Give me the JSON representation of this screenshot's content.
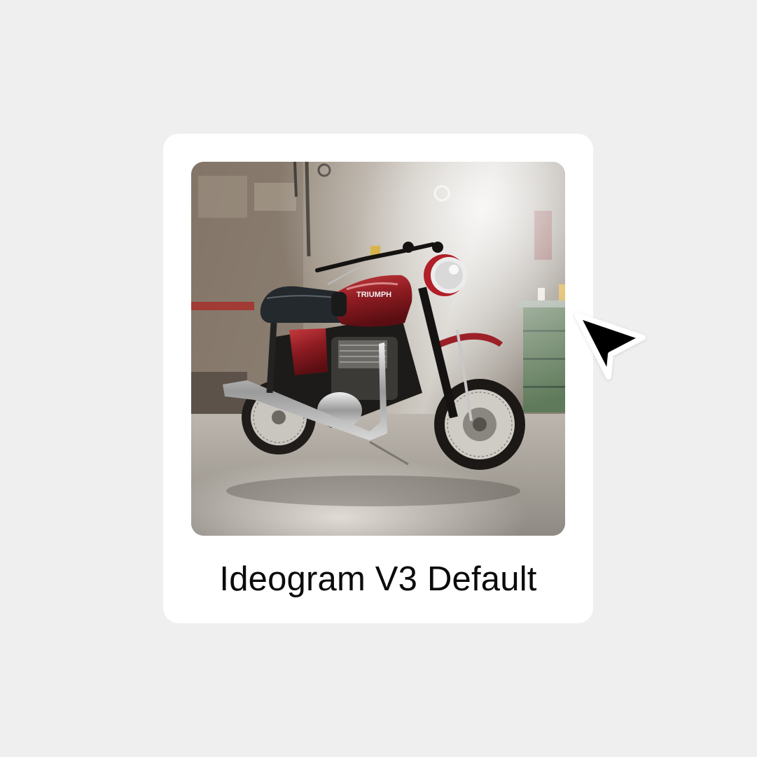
{
  "card": {
    "caption": "Ideogram V3 Default",
    "image_subject": "red Triumph motorcycle in a workshop garage",
    "tank_badge": "TRIUMPH"
  },
  "cursor": {
    "icon": "pointer-arrow-icon"
  },
  "colors": {
    "background": "#efefef",
    "card": "#ffffff",
    "caption_text": "#0b0b0b",
    "cursor": "#000000"
  }
}
